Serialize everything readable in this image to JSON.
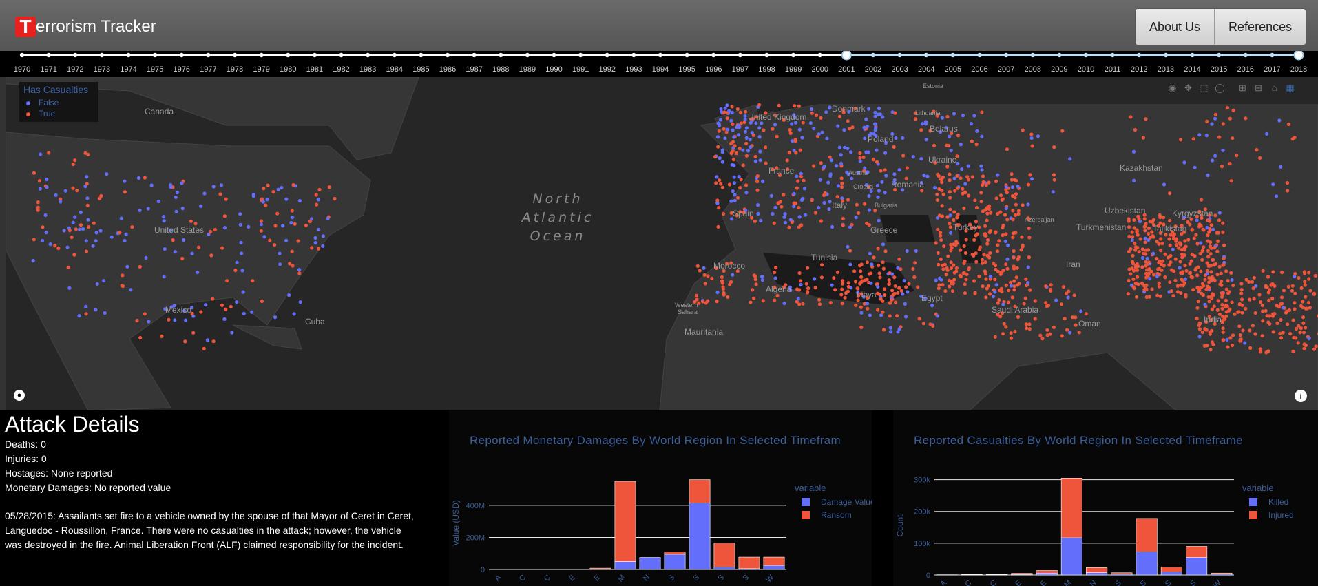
{
  "header": {
    "logo_letter": "T",
    "title": "errorism Tracker",
    "nav": [
      "About Us",
      "References"
    ]
  },
  "timeline": {
    "years": [
      "1970",
      "1971",
      "1972",
      "1973",
      "1974",
      "1975",
      "1976",
      "1977",
      "1978",
      "1979",
      "1980",
      "1981",
      "1982",
      "1983",
      "1984",
      "1985",
      "1986",
      "1987",
      "1988",
      "1989",
      "1990",
      "1991",
      "1992",
      "1993",
      "1994",
      "1995",
      "1996",
      "1997",
      "1998",
      "1999",
      "2000",
      "2001",
      "2002",
      "2003",
      "2004",
      "2005",
      "2006",
      "2007",
      "2008",
      "2009",
      "2010",
      "2011",
      "2012",
      "2013",
      "2014",
      "2015",
      "2016",
      "2017",
      "2018"
    ],
    "range_start": "2001",
    "range_end": "2018"
  },
  "map": {
    "legend": {
      "title": "Has Casualties",
      "items": [
        {
          "label": "False",
          "color": "#636efa"
        },
        {
          "label": "True",
          "color": "#ef553b"
        }
      ]
    },
    "labels": {
      "canada": "Canada",
      "us": "United States",
      "mexico": "Mexico",
      "cuba": "Cuba",
      "ocean": "North Atlantic Ocean",
      "ocean_1": "North",
      "ocean_2": "Atlantic",
      "ocean_3": "Ocean",
      "uk": "United Kingdom",
      "denmark": "Denmark",
      "estonia": "Estonia",
      "lithuania": "Lithuania",
      "belarus": "Belarus",
      "poland": "Poland",
      "ukraine": "Ukraine",
      "kazakhstan": "Kazakhstan",
      "france": "France",
      "austria": "Austria",
      "romania": "Romania",
      "croatia": "Croatia",
      "bulgaria": "Bulgaria",
      "italy": "Italy",
      "spain": "Spain",
      "greece": "Greece",
      "turkey": "Turkey",
      "azerbaijan": "Azerbaijan",
      "uzbekistan": "Uzbekistan",
      "kyrgyzstan": "Kyrgyzstan",
      "turkmenistan": "Turkmenistan",
      "tajikistan": "Tajikistan",
      "tunisia": "Tunisia",
      "morocco": "Morocco",
      "algeria": "Algeria",
      "libya": "Libya",
      "egypt": "Egypt",
      "iran": "Iran",
      "saudi": "Saudi Arabia",
      "oman": "Oman",
      "india": "India",
      "western_sahara": "Western Sahara",
      "western": "Western",
      "sahara": "Sahara",
      "mauritania": "Mauritania"
    },
    "modebar_icons": [
      "camera-icon",
      "pan-icon",
      "box-select-icon",
      "lasso-icon",
      "zoom-in-icon",
      "zoom-out-icon",
      "home-icon",
      "plotly-logo-icon"
    ]
  },
  "details": {
    "heading": "Attack Details",
    "deaths": "Deaths: 0",
    "injuries": "Injuries: 0",
    "hostages": "Hostages: None reported",
    "damages": "Monetary Damages: No reported value",
    "description": "05/28/2015: Assailants set fire to a vehicle owned by the spouse of that Mayor of Ceret in Ceret, Languedoc - Roussillon, France. There were no casualties in the attack; however, the vehicle was destroyed in the fire. Animal Liberation Front (ALF) claimed responsibility for the incident."
  },
  "chart_data": [
    {
      "type": "bar",
      "stacked": true,
      "title": "Reported Monetary Damages By World Region In Selected Timefram",
      "ylabel": "Value (USD)",
      "yticks": [
        "0",
        "200M",
        "400M"
      ],
      "ylim": [
        0,
        580
      ],
      "legend_title": "variable",
      "legend_position": "right",
      "categories": [
        "A",
        "C",
        "C",
        "E",
        "E",
        "M",
        "N",
        "S",
        "S",
        "S",
        "S",
        "W"
      ],
      "series": [
        {
          "name": "Damage Value",
          "color": "#636efa",
          "values": [
            0,
            0,
            0,
            0,
            2,
            50,
            75,
            95,
            415,
            15,
            5,
            25
          ]
        },
        {
          "name": "Ransom",
          "color": "#ef553b",
          "values": [
            0,
            0,
            0,
            0,
            6,
            500,
            0,
            15,
            145,
            150,
            72,
            52
          ]
        }
      ]
    },
    {
      "type": "bar",
      "stacked": true,
      "title": "Reported Casualties By World Region In Selected Timeframe",
      "ylabel": "Count",
      "yticks": [
        "0",
        "100k",
        "200k",
        "300k"
      ],
      "ylim": [
        0,
        310
      ],
      "legend_title": "variable",
      "legend_position": "right",
      "categories": [
        "A",
        "C",
        "C",
        "E",
        "E",
        "M",
        "N",
        "S",
        "S",
        "S",
        "S",
        "W"
      ],
      "series": [
        {
          "name": "Killed",
          "color": "#636efa",
          "values": [
            0.3,
            0.5,
            0.5,
            2,
            6,
            117,
            8,
            3,
            73,
            10,
            55,
            3
          ]
        },
        {
          "name": "Injured",
          "color": "#ef553b",
          "values": [
            0.5,
            1,
            1,
            3,
            8,
            188,
            15,
            4,
            105,
            15,
            35,
            3
          ]
        }
      ]
    }
  ]
}
